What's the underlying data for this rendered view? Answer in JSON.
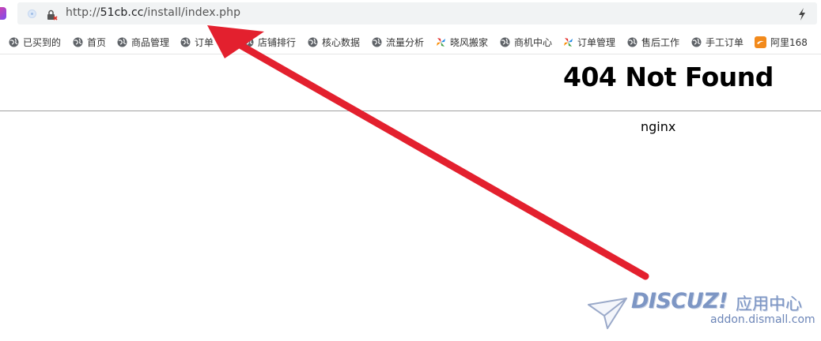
{
  "address_bar": {
    "url_scheme": "http://",
    "url_host": "51cb.cc",
    "url_path": "/install/index.php"
  },
  "bookmarks": [
    {
      "label": "已买到的",
      "icon": "globe-icon"
    },
    {
      "label": "首页",
      "icon": "globe-icon"
    },
    {
      "label": "商品管理",
      "icon": "globe-icon"
    },
    {
      "label": "订单",
      "icon": "globe-icon"
    },
    {
      "label": "店铺排行",
      "icon": "globe-icon"
    },
    {
      "label": "核心数据",
      "icon": "globe-icon"
    },
    {
      "label": "流量分析",
      "icon": "globe-icon"
    },
    {
      "label": "晓风搬家",
      "icon": "pinwheel-icon"
    },
    {
      "label": "商机中心",
      "icon": "globe-icon"
    },
    {
      "label": "订单管理",
      "icon": "pinwheel-icon"
    },
    {
      "label": "售后工作",
      "icon": "globe-icon"
    },
    {
      "label": "手工订单",
      "icon": "globe-icon"
    },
    {
      "label": "阿里168",
      "icon": "alibaba-icon"
    }
  ],
  "page": {
    "title": "404 Not Found",
    "server": "nginx"
  },
  "watermark": {
    "brand": "DISCUZ!",
    "brand_cn": "应用中心",
    "site": "addon.dismall.com"
  },
  "colors": {
    "arrow": "#e3202e",
    "watermark": "#7d96c4",
    "bookmark_icon": "#5f6368"
  }
}
